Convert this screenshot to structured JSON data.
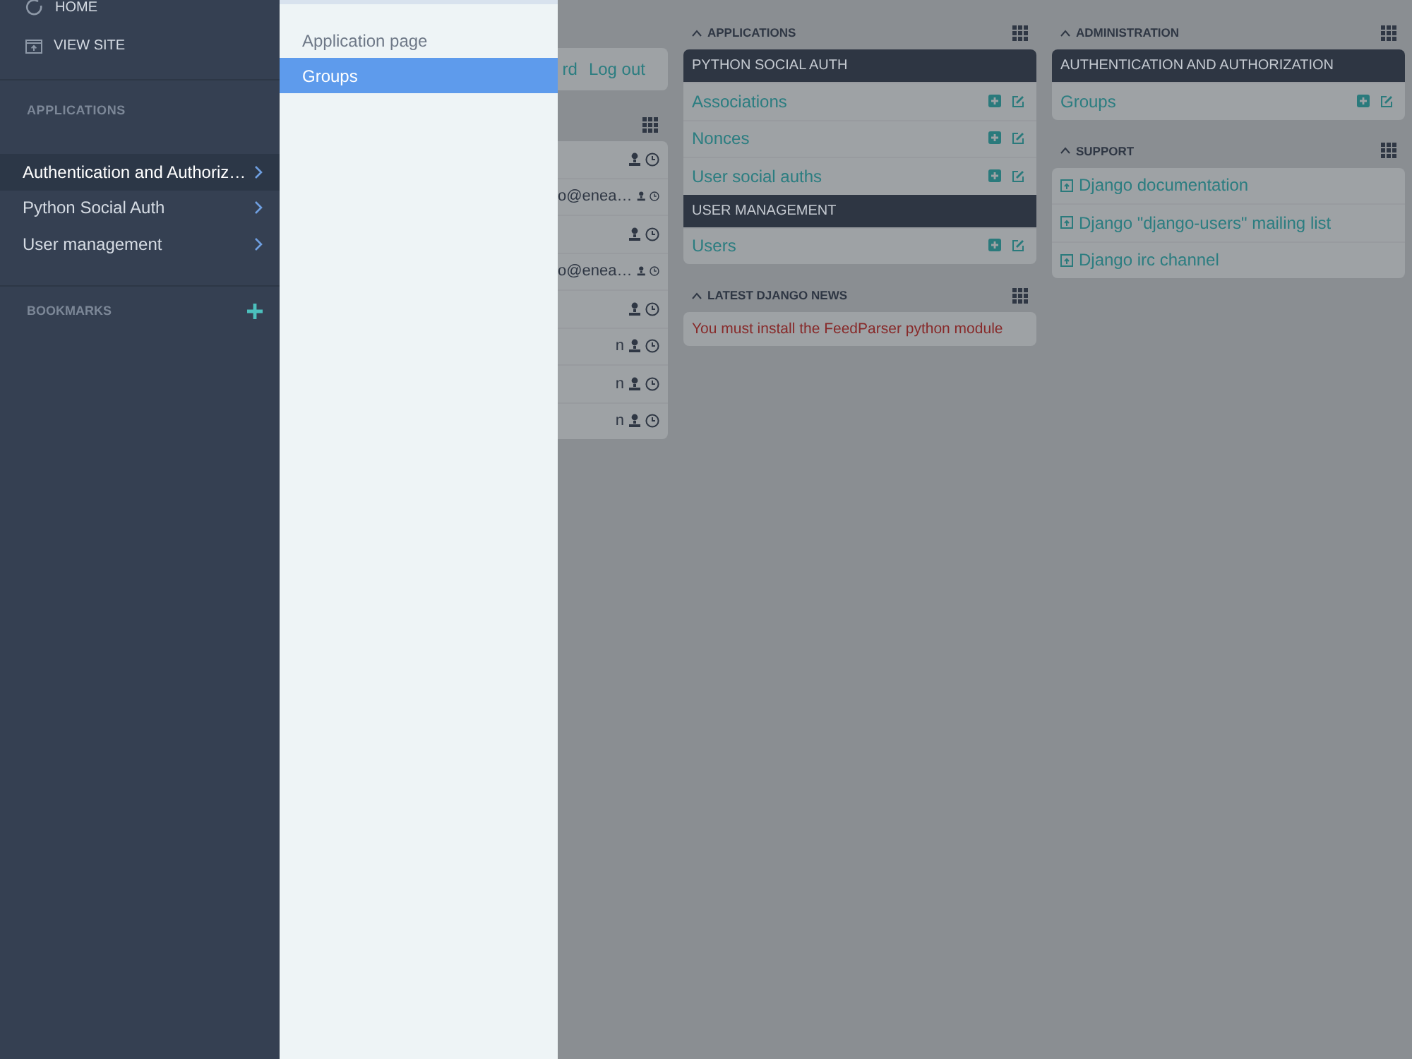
{
  "sidebar": {
    "top_links": [
      {
        "label": "HOME"
      },
      {
        "label": "VIEW SITE"
      }
    ],
    "section_title": "APPLICATIONS",
    "apps": [
      {
        "label": "Authentication and Authoriz…",
        "selected": true
      },
      {
        "label": "Python Social Auth",
        "selected": false
      },
      {
        "label": "User management",
        "selected": false
      }
    ],
    "bookmarks_title": "BOOKMARKS"
  },
  "submenu": {
    "items": [
      {
        "label": "Application page",
        "selected": false
      },
      {
        "label": "Groups",
        "selected": true
      }
    ]
  },
  "dashboard": {
    "column_1": {
      "header_links": [
        "rd",
        "Log out"
      ],
      "rows": [
        {},
        {
          "text": "o@enea…"
        },
        {},
        {
          "text": "o@enea…"
        },
        {},
        {
          "text": "n"
        },
        {
          "text": "n"
        },
        {
          "text": "n"
        }
      ]
    },
    "columns": [
      [
        {
          "kind": "app_list",
          "title": "APPLICATIONS",
          "groups": [
            {
              "title": "PYTHON SOCIAL AUTH",
              "models": [
                "Associations",
                "Nonces",
                "User social auths"
              ]
            },
            {
              "title": "USER MANAGEMENT",
              "models": [
                "Users"
              ]
            }
          ]
        },
        {
          "kind": "feed",
          "title": "LATEST DJANGO NEWS",
          "message": "You must install the FeedParser python module"
        }
      ],
      [
        {
          "kind": "app_list",
          "title": "ADMINISTRATION",
          "groups": [
            {
              "title": "AUTHENTICATION AND AUTHORIZATION",
              "models": [
                "Groups"
              ]
            }
          ]
        },
        {
          "kind": "link_list",
          "title": "SUPPORT",
          "links": [
            "Django documentation",
            "Django \"django-users\" mailing list",
            "Django irc channel"
          ]
        }
      ]
    ]
  }
}
